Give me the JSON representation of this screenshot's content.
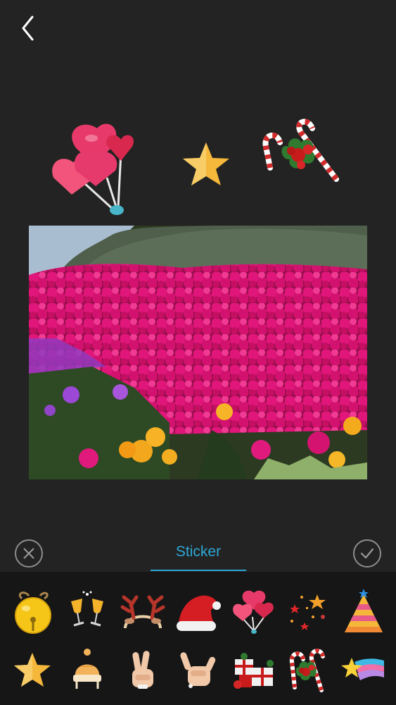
{
  "editor": {
    "back_icon": "chevron-left-icon",
    "tab_label": "Sticker",
    "cancel_icon": "close-icon",
    "confirm_icon": "checkmark-icon",
    "accent_color": "#2ea7d6"
  },
  "canvas": {
    "placed_stickers": [
      "heart-balloons",
      "gold-star",
      "candy-canes"
    ]
  },
  "photo": {
    "subject": "pink-flowers-photo"
  },
  "sticker_tray": {
    "row1": [
      "jingle-bell",
      "champagne-toast",
      "reindeer-antlers",
      "santa-hat",
      "heart-balloons",
      "confetti-stars",
      "party-hat"
    ],
    "row2": [
      "gold-star",
      "winter-beanie",
      "peace-hand",
      "shaka-hand",
      "gift-boxes",
      "candy-canes",
      "shooting-star"
    ]
  }
}
